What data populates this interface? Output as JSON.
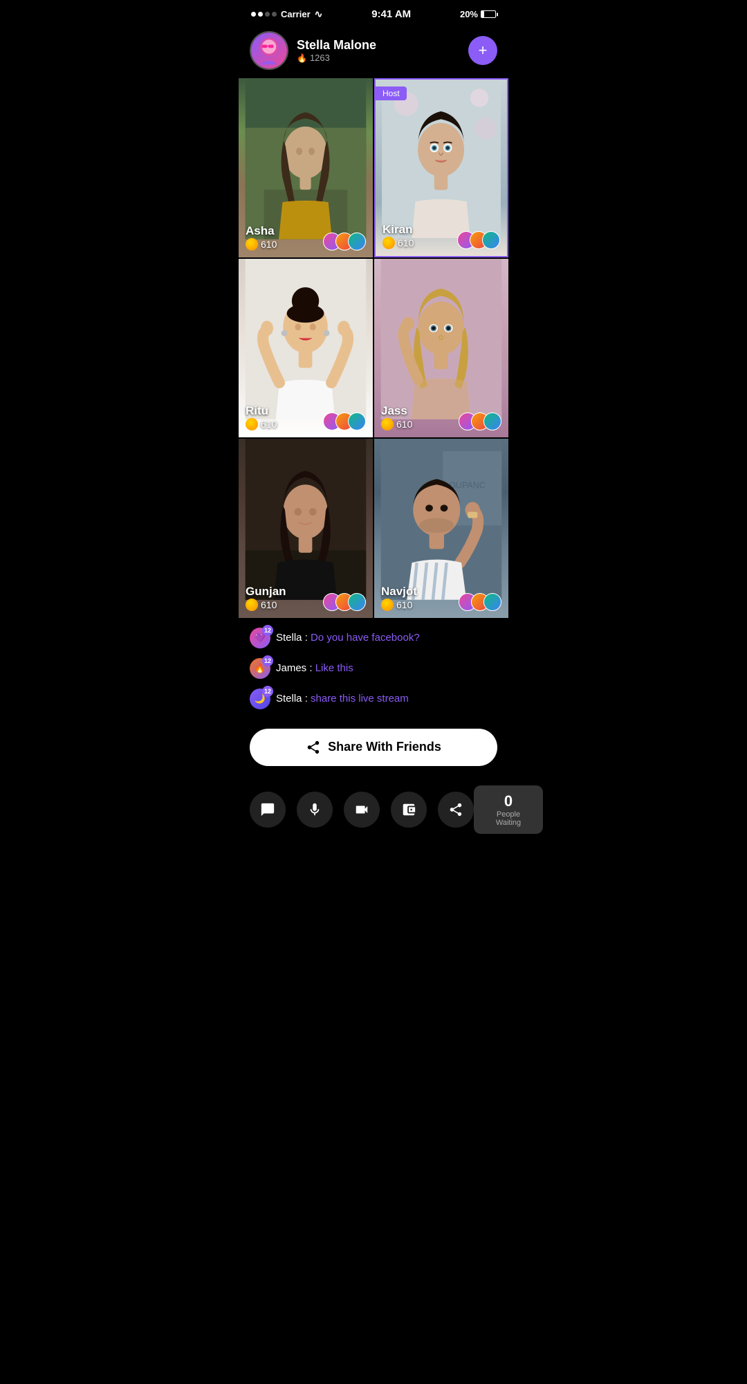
{
  "statusBar": {
    "carrier": "Carrier",
    "time": "9:41 AM",
    "battery": "20%",
    "signalDots": [
      true,
      true,
      false,
      false
    ]
  },
  "userHeader": {
    "name": "Stella Malone",
    "score": "1263",
    "fireIcon": "🔥",
    "addLabel": "+"
  },
  "grid": [
    {
      "id": "asha",
      "name": "Asha",
      "coins": "610",
      "isHost": false,
      "bgClass": "bg-asha"
    },
    {
      "id": "kiran",
      "name": "Kiran",
      "coins": "610",
      "isHost": true,
      "bgClass": "bg-kiran"
    },
    {
      "id": "ritu",
      "name": "Ritu",
      "coins": "610",
      "isHost": false,
      "bgClass": "bg-ritu"
    },
    {
      "id": "jass",
      "name": "Jass",
      "coins": "610",
      "isHost": false,
      "bgClass": "bg-jass"
    },
    {
      "id": "gunjan",
      "name": "Gunjan",
      "coins": "610",
      "isHost": false,
      "bgClass": "bg-gunjan"
    },
    {
      "id": "navjot",
      "name": "Navjot",
      "coins": "610",
      "isHost": false,
      "bgClass": "bg-navjot"
    }
  ],
  "hostLabel": "Host",
  "chat": {
    "messages": [
      {
        "sender": "Stella",
        "badgeType": "heart",
        "badgeNum": "12",
        "text": "Do you have facebook?"
      },
      {
        "sender": "James",
        "badgeType": "fire",
        "badgeNum": "12",
        "text": "Like this"
      },
      {
        "sender": "Stella",
        "badgeType": "moon",
        "badgeNum": "12",
        "text": "share this live stream"
      }
    ]
  },
  "shareButton": {
    "label": "Share With Friends"
  },
  "bottomBar": {
    "buttons": [
      {
        "id": "chat",
        "icon": "chat"
      },
      {
        "id": "mic",
        "icon": "mic"
      },
      {
        "id": "video",
        "icon": "video"
      },
      {
        "id": "wallet",
        "icon": "wallet"
      },
      {
        "id": "share",
        "icon": "share"
      }
    ],
    "peopleWaiting": {
      "count": "0",
      "label": "People Waiting"
    }
  }
}
